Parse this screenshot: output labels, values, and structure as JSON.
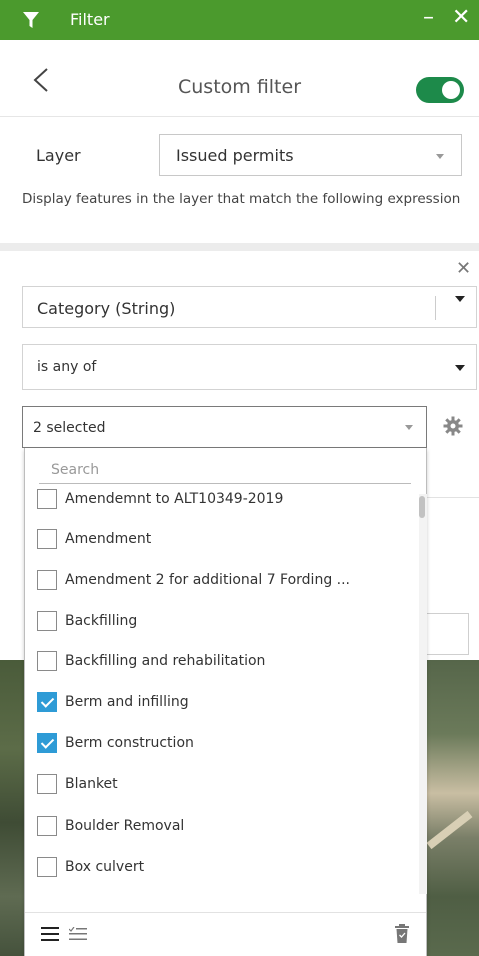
{
  "window": {
    "title": "Filter",
    "minimize_glyph": "–",
    "close_glyph": "✕",
    "icon": "funnel-icon",
    "accent_color": "#4b9a2d"
  },
  "header": {
    "title": "Custom filter",
    "back_icon": "chevron-left-icon",
    "toggle_on": true
  },
  "layer": {
    "label": "Layer",
    "selected": "Issued permits"
  },
  "description": "Display features in the layer that match the following expression",
  "expression": {
    "remove_glyph": "✕",
    "field": "Category (String)",
    "operator": "is any of",
    "value_summary": "2 selected"
  },
  "dropdown": {
    "search_placeholder": "Search",
    "items": [
      {
        "label": "Amendemnt to ALT10349-2019",
        "checked": false
      },
      {
        "label": "Amendment",
        "checked": false
      },
      {
        "label": "Amendment 2 for additional 7 Fording ...",
        "checked": false
      },
      {
        "label": "Backfilling",
        "checked": false
      },
      {
        "label": "Backfilling and rehabilitation",
        "checked": false
      },
      {
        "label": "Berm and infilling",
        "checked": true
      },
      {
        "label": "Berm construction",
        "checked": true
      },
      {
        "label": "Blanket",
        "checked": false
      },
      {
        "label": "Boulder Removal",
        "checked": false
      },
      {
        "label": "Box culvert",
        "checked": false
      }
    ],
    "footer_icons": [
      "list-all-icon",
      "list-selected-icon",
      "trash-icon"
    ]
  }
}
